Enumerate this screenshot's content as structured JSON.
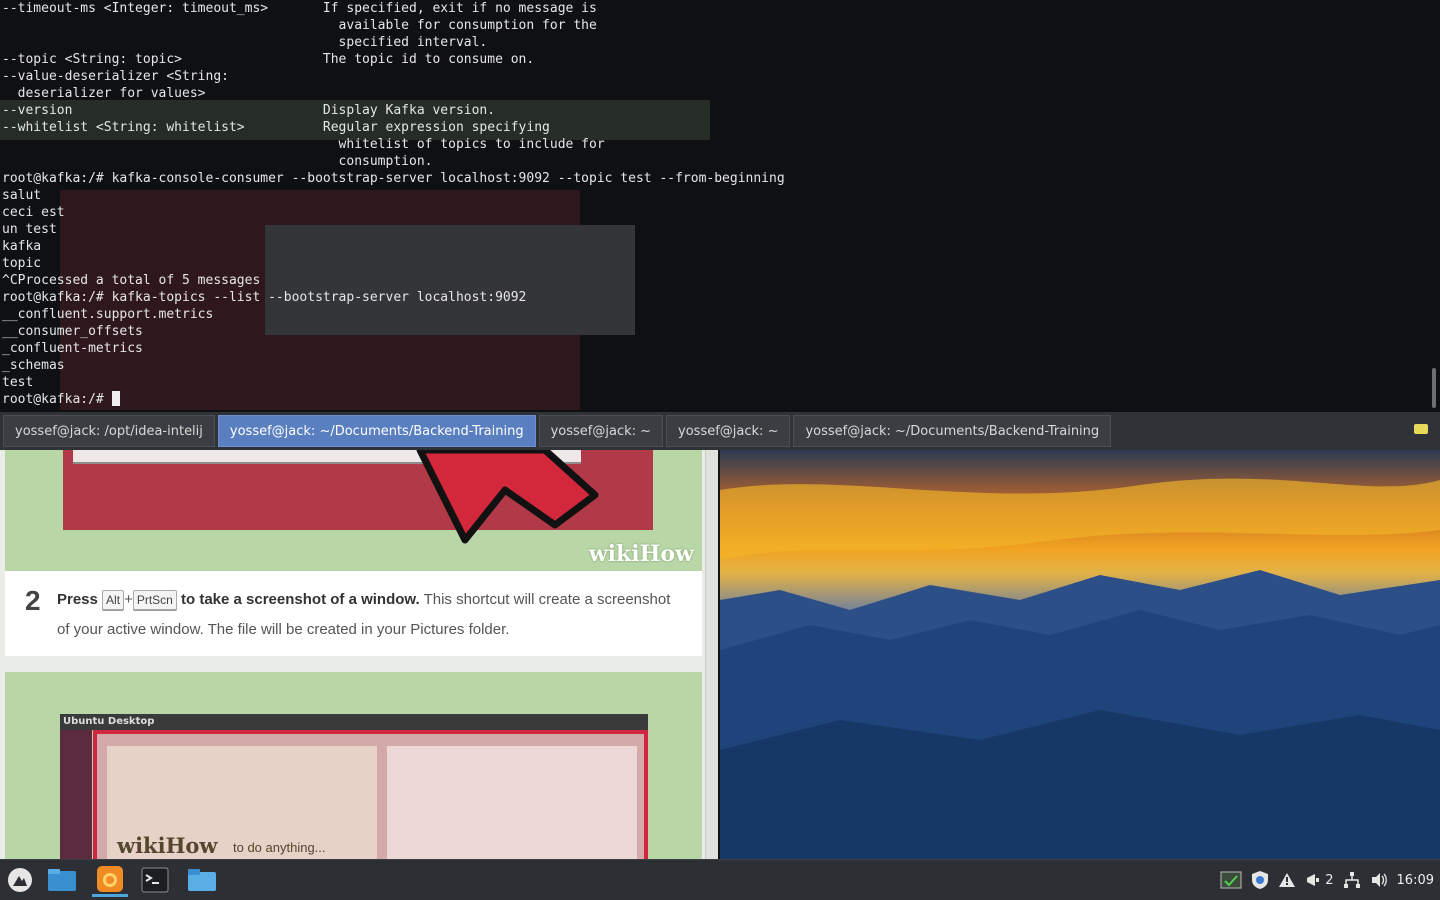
{
  "terminal": {
    "lines": [
      "--timeout-ms <Integer: timeout_ms>       If specified, exit if no message is",
      "                                           available for consumption for the",
      "                                           specified interval.",
      "--topic <String: topic>                  The topic id to consume on.",
      "--value-deserializer <String:",
      "  deserializer for values>",
      "--version                                Display Kafka version.",
      "--whitelist <String: whitelist>          Regular expression specifying",
      "                                           whitelist of topics to include for",
      "                                           consumption.",
      "root@kafka:/# kafka-console-consumer --bootstrap-server localhost:9092 --topic test --from-beginning",
      "salut",
      "ceci est",
      "un test",
      "kafka",
      "topic",
      "^CProcessed a total of 5 messages",
      "root@kafka:/# kafka-topics --list --bootstrap-server localhost:9092",
      "__confluent.support.metrics",
      "__consumer_offsets",
      "_confluent-metrics",
      "_schemas",
      "test"
    ],
    "prompt": "root@kafka:/# "
  },
  "tabs": [
    {
      "label": "yossef@jack: /opt/idea-intelij",
      "active": false
    },
    {
      "label": "yossef@jack: ~/Documents/Backend-Training",
      "active": true
    },
    {
      "label": "yossef@jack: ~",
      "active": false
    },
    {
      "label": "yossef@jack: ~",
      "active": false
    },
    {
      "label": "yossef@jack: ~/Documents/Backend-Training",
      "active": false
    }
  ],
  "wiki": {
    "logo": "wikiHow",
    "step_number": "2",
    "step_press": "Press",
    "key_alt": "Alt",
    "key_plus": "+",
    "key_prtscn": "PrtScn",
    "step_bold": "to take a screenshot of a window.",
    "step_rest": "This shortcut will create a screenshot of your active window. The file will be created in your Pictures folder.",
    "ubuntu_title": "Ubuntu Desktop",
    "ubuntu_logo": "wikiHow",
    "ubuntu_tag": "to do anything..."
  },
  "taskbar": {
    "apps": [
      "menu-icon",
      "files-icon",
      "firefox-icon",
      "terminal-icon",
      "folder-icon"
    ],
    "tray_badge": "2",
    "clock": "16:09"
  },
  "colors": {
    "accent": "#5a7fc0",
    "taskbar": "#2c3034",
    "terminal_text": "#e6e6e6"
  }
}
